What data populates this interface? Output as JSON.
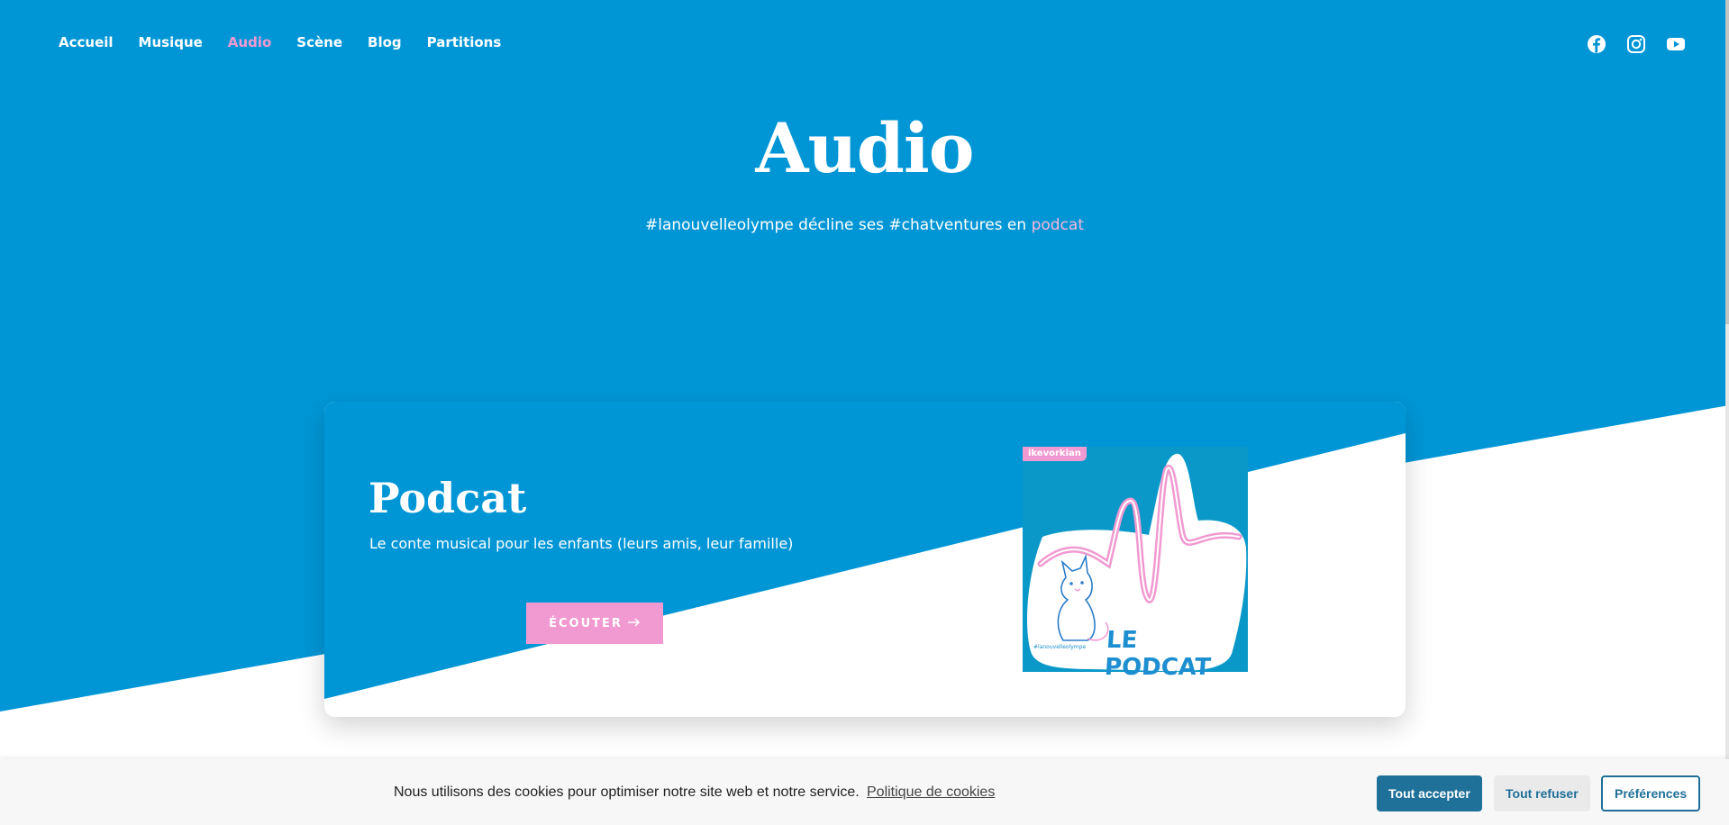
{
  "nav": {
    "items": [
      {
        "label": "Accueil"
      },
      {
        "label": "Musique"
      },
      {
        "label": "Audio"
      },
      {
        "label": "Scène"
      },
      {
        "label": "Blog"
      },
      {
        "label": "Partitions"
      }
    ],
    "active_index": 2
  },
  "social": [
    "facebook-icon",
    "instagram-icon",
    "youtube-icon"
  ],
  "hero": {
    "title": "Audio",
    "subtitle_text": "#lanouvelleolympe décline ses #chatventures en ",
    "subtitle_link": "podcat"
  },
  "card": {
    "title": "Podcat",
    "description": "Le conte musical pour les enfants (leurs amis, leur famille)",
    "button_label": "ÉCOUTER",
    "button_icon": "arrow-right-icon",
    "cover": {
      "brand": "ikevorkian",
      "title": "LE PODCAT",
      "tag": "#lanouvelleolympe"
    }
  },
  "cookie": {
    "text": "Nous utilisons des cookies pour optimiser notre site web et notre service.",
    "policy_link": "Politique de cookies",
    "accept": "Tout accepter",
    "refuse": "Tout refuser",
    "preferences": "Préférences"
  },
  "colors": {
    "brand_blue": "#0096d6",
    "accent_pink": "#f19ad1",
    "cookie_button": "#1f7199"
  }
}
